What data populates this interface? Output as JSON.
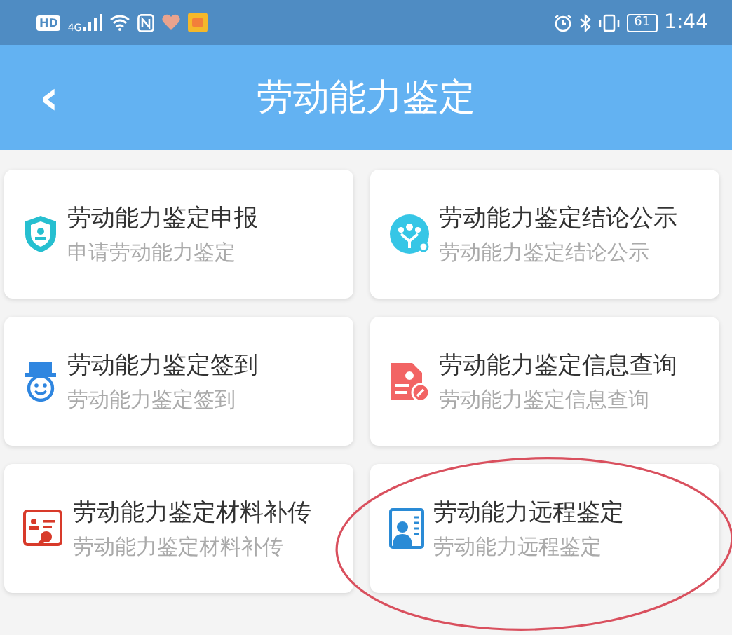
{
  "status_bar": {
    "hd": "HD",
    "network": "4G",
    "battery": "61",
    "time": "1:44"
  },
  "header": {
    "back": "‹",
    "title": "劳动能力鉴定"
  },
  "cards": [
    {
      "kind": "shield",
      "title": "劳动能力鉴定申报",
      "subtitle": "申请劳动能力鉴定",
      "circled": false
    },
    {
      "kind": "group",
      "title": "劳动能力鉴定结论公示",
      "subtitle": "劳动能力鉴定结论公示",
      "circled": false
    },
    {
      "kind": "mascot",
      "title": "劳动能力鉴定签到",
      "subtitle": "劳动能力鉴定签到",
      "circled": false
    },
    {
      "kind": "document",
      "title": "劳动能力鉴定信息查询",
      "subtitle": "劳动能力鉴定信息查询",
      "circled": false
    },
    {
      "kind": "certificate",
      "title": "劳动能力鉴定材料补传",
      "subtitle": "劳动能力鉴定材料补传",
      "circled": false
    },
    {
      "kind": "idcard",
      "title": "劳动能力远程鉴定",
      "subtitle": "劳动能力远程鉴定",
      "circled": true
    }
  ]
}
